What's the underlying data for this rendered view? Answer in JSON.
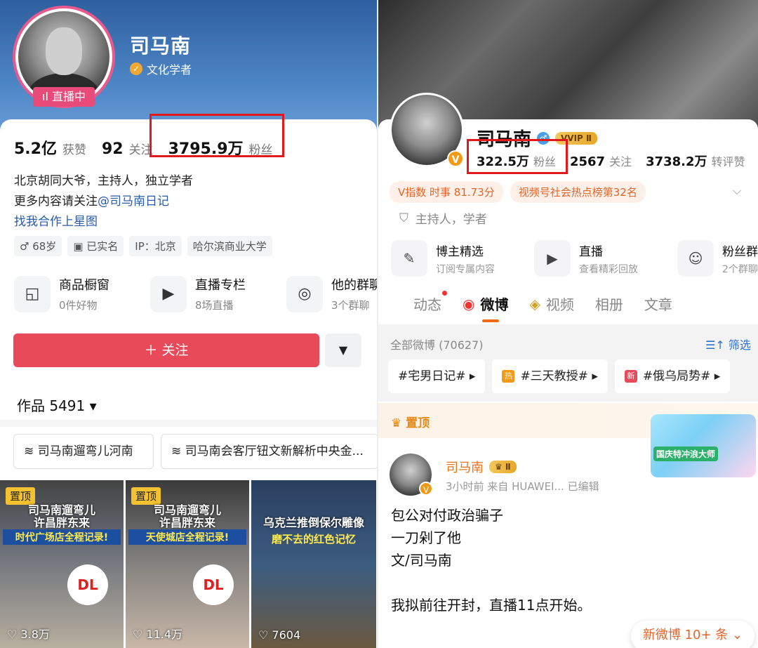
{
  "left": {
    "profile_name": "司马南",
    "verified_title": "文化学者",
    "live_badge": "ıl 直播中",
    "stats": {
      "likes_value": "5.2亿",
      "likes_label": "获赞",
      "following_value": "92",
      "following_label": "关注",
      "fans_value": "3795.9万",
      "fans_label": "粉丝"
    },
    "bio_line1": "北京胡同大爷，主持人，独立学者",
    "bio_line2_prefix": "更多内容请关注",
    "bio_line2_link": "@司马南日记",
    "bio_line3": "找我合作上星图",
    "tags": [
      "♂ 68岁",
      "▣ 已实名",
      "IP：北京",
      "哈尔滨商业大学"
    ],
    "tools": [
      {
        "title": "商品橱窗",
        "sub": "0件好物",
        "icon": "bag-icon",
        "glyph": "◱"
      },
      {
        "title": "直播专栏",
        "sub": "8场直播",
        "icon": "tv-icon",
        "glyph": "▶"
      },
      {
        "title": "他的群聊",
        "sub": "3个群聊",
        "icon": "chat-icon",
        "glyph": "◎"
      }
    ],
    "follow_label": "＋ 关注",
    "more_label": "▼",
    "works_label": "作品 5491 ▾",
    "collections": [
      "≋ 司马南遛弯儿河南",
      "≋ 司马南会客厅钮文新解析中央金..."
    ],
    "videos": [
      {
        "pin": "置顶",
        "title": "司马南遛弯儿\n许昌胖东来",
        "sub": "时代广场店全程记录!",
        "likes": "♡ 3.8万",
        "logo": "DL"
      },
      {
        "pin": "置顶",
        "title": "司马南遛弯儿\n许昌胖东来",
        "sub": "天使城店全程记录!",
        "likes": "♡ 11.4万",
        "logo": "DL"
      },
      {
        "pin": "",
        "title": "乌克兰推倒保尔雕像",
        "sub": "磨不去的红色记忆",
        "likes": "♡ 7604",
        "logo": ""
      }
    ]
  },
  "right": {
    "profile_name": "司马南",
    "vip_badge": "VVIP Ⅱ",
    "stats": {
      "fans_value": "322.5万",
      "fans_label": "粉丝",
      "following_value": "2567",
      "following_label": "关注",
      "reposts_value": "3738.2万",
      "reposts_label": "转评赞"
    },
    "chips": [
      "V指数 时事 81.73分",
      "视频号社会热点榜第32名"
    ],
    "desc": "主持人，学者",
    "tools": [
      {
        "title": "博主精选",
        "sub": "订阅专属内容",
        "glyph": "✎"
      },
      {
        "title": "直播",
        "sub": "查看精彩回放",
        "glyph": "▶"
      },
      {
        "title": "粉丝群",
        "sub": "2个群聊",
        "glyph": "☺"
      }
    ],
    "tabs": [
      "动态",
      "微博",
      "视频",
      "相册",
      "文章"
    ],
    "all_posts": "全部微博 (70627)",
    "filter": "☰↑ 筛选",
    "topics": [
      {
        "tag": "",
        "text": "#宅男日记# ▸"
      },
      {
        "tag": "热",
        "text": "#三天教授# ▸"
      },
      {
        "tag": "新",
        "text": "#俄乌局势# ▸"
      }
    ],
    "pinned_label": "♛ 置顶",
    "festival": "国庆特冲浪大师",
    "post": {
      "author": "司马南",
      "level": "♛ Ⅱ",
      "meta": "3小时前  来自 HUAWEI... 已编辑",
      "body": [
        "包公对付政治骗子",
        "一刀剁了他",
        "文/司马南",
        "",
        "我拟前往开封，直播11点开始。"
      ]
    },
    "new_posts": "新微博 10+ 条 ⌄"
  }
}
